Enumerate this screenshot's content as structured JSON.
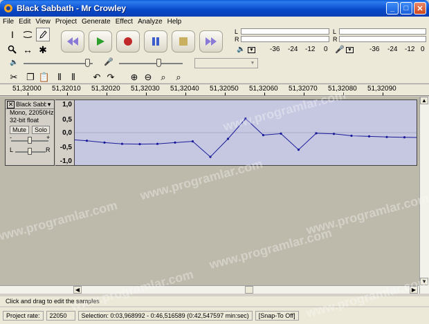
{
  "window": {
    "title": "Black Sabbath - Mr Crowley"
  },
  "menu": [
    "File",
    "Edit",
    "View",
    "Project",
    "Generate",
    "Effect",
    "Analyze",
    "Help"
  ],
  "meters": {
    "play": {
      "ticks": [
        "-36",
        "-24",
        "-12",
        "0"
      ]
    },
    "record": {
      "ticks": [
        "-36",
        "-24",
        "-12",
        "0"
      ]
    },
    "channel_left": "L",
    "channel_right": "R"
  },
  "ruler": {
    "ticks": [
      "51,32000",
      "51,32010",
      "51,32020",
      "51,32030",
      "51,32040",
      "51,32050",
      "51,32060",
      "51,32070",
      "51,32080",
      "51,32090"
    ]
  },
  "track": {
    "name": "Black Sabb",
    "info_rate": "Mono, 22050Hz",
    "info_format": "32-bit float",
    "mute_label": "Mute",
    "solo_label": "Solo",
    "pan_left": "L",
    "pan_right": "R",
    "gain_minus": "-",
    "gain_plus": "+",
    "scale": [
      "1,0",
      "0,5",
      "0,0",
      "-0,5",
      "-1,0"
    ],
    "samples": [
      -0.22,
      -0.26,
      -0.32,
      -0.36,
      -0.37,
      -0.36,
      -0.32,
      -0.28,
      -0.78,
      -0.2,
      0.45,
      -0.08,
      -0.03,
      -0.55,
      -0.02,
      -0.04,
      -0.1,
      -0.12,
      -0.14,
      -0.15,
      -0.16,
      -0.16
    ]
  },
  "status": {
    "hint": "Click and drag to edit the samples",
    "project_rate_label": "Project rate:",
    "project_rate": "22050",
    "selection": "Selection: 0:03,968992 - 0:46,516589 (0:42,547597 min:sec)",
    "snap": "[Snap-To Off]"
  },
  "watermark": "www.programlar.com",
  "colors": {
    "wave_bg": "#c5c8e0",
    "wave_line": "#1a1a9a",
    "titlebar": "#0a5ad6"
  }
}
